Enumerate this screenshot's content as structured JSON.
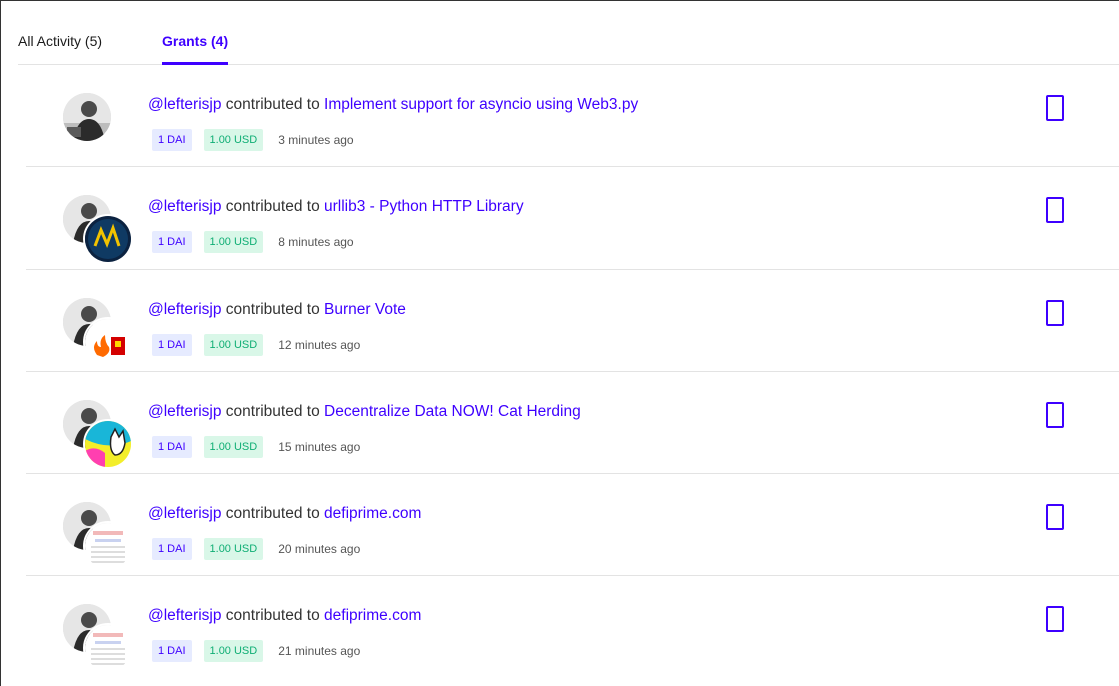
{
  "tabs": [
    {
      "label": "All Activity (5)",
      "active": false
    },
    {
      "label": "Grants (4)",
      "active": true
    }
  ],
  "accent_color": "#3e00ff",
  "rows": [
    {
      "user": "@lefterisjp",
      "verb": "contributed to",
      "grant": "Implement support for asyncio using Web3.py",
      "token": "1 DAI",
      "usd": "1.00 USD",
      "time": "3 minutes ago"
    },
    {
      "user": "@lefterisjp",
      "verb": "contributed to",
      "grant": "urllib3 - Python HTTP Library",
      "token": "1 DAI",
      "usd": "1.00 USD",
      "time": "8 minutes ago"
    },
    {
      "user": "@lefterisjp",
      "verb": "contributed to",
      "grant": "Burner Vote",
      "token": "1 DAI",
      "usd": "1.00 USD",
      "time": "12 minutes ago"
    },
    {
      "user": "@lefterisjp",
      "verb": "contributed to",
      "grant": "Decentralize Data NOW! Cat Herding",
      "token": "1 DAI",
      "usd": "1.00 USD",
      "time": "15 minutes ago"
    },
    {
      "user": "@lefterisjp",
      "verb": "contributed to",
      "grant": "defiprime.com",
      "token": "1 DAI",
      "usd": "1.00 USD",
      "time": "20 minutes ago"
    },
    {
      "user": "@lefterisjp",
      "verb": "contributed to",
      "grant": "defiprime.com",
      "token": "1 DAI",
      "usd": "1.00 USD",
      "time": "21 minutes ago"
    }
  ]
}
